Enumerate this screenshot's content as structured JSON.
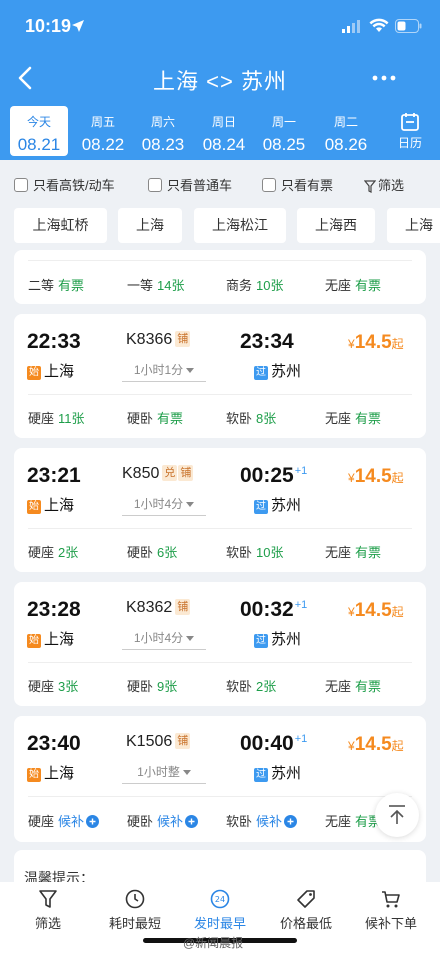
{
  "status_bar": {
    "time": "10:19"
  },
  "header": {
    "title": "上海 <> 苏州"
  },
  "dates": [
    {
      "weekday": "今天",
      "date": "08.21",
      "active": true
    },
    {
      "weekday": "周五",
      "date": "08.22"
    },
    {
      "weekday": "周六",
      "date": "08.23"
    },
    {
      "weekday": "周日",
      "date": "08.24"
    },
    {
      "weekday": "周一",
      "date": "08.25"
    },
    {
      "weekday": "周二",
      "date": "08.26"
    }
  ],
  "calendar_label": "日历",
  "filters": {
    "high_speed": "只看高铁/动车",
    "regular": "只看普通车",
    "available": "只看有票",
    "filter_label": "筛选"
  },
  "stations": [
    "上海虹桥",
    "上海",
    "上海松江",
    "上海西",
    "上海"
  ],
  "partial_seats": [
    {
      "type": "二等",
      "status": "有票"
    },
    {
      "type": "一等",
      "status": "14张"
    },
    {
      "type": "商务",
      "status": "10张"
    },
    {
      "type": "无座",
      "status": "有票"
    }
  ],
  "trains": [
    {
      "dep_time": "22:33",
      "dep_badge": "始",
      "dep_station": "上海",
      "train_no": "K8366",
      "tags": [
        "铺"
      ],
      "duration": "1小时1分",
      "arr_time": "23:34",
      "arr_plus": "",
      "arr_badge": "过",
      "arr_station": "苏州",
      "price_currency": "¥",
      "price": "14.5",
      "price_suffix": "起",
      "seats": [
        {
          "type": "硬座",
          "status": "11张"
        },
        {
          "type": "硬卧",
          "status": "有票"
        },
        {
          "type": "软卧",
          "status": "8张"
        },
        {
          "type": "无座",
          "status": "有票"
        }
      ]
    },
    {
      "dep_time": "23:21",
      "dep_badge": "始",
      "dep_station": "上海",
      "train_no": "K850",
      "tags": [
        "兑",
        "铺"
      ],
      "duration": "1小时4分",
      "arr_time": "00:25",
      "arr_plus": "+1",
      "arr_badge": "过",
      "arr_station": "苏州",
      "price_currency": "¥",
      "price": "14.5",
      "price_suffix": "起",
      "seats": [
        {
          "type": "硬座",
          "status": "2张"
        },
        {
          "type": "硬卧",
          "status": "6张"
        },
        {
          "type": "软卧",
          "status": "10张"
        },
        {
          "type": "无座",
          "status": "有票"
        }
      ]
    },
    {
      "dep_time": "23:28",
      "dep_badge": "始",
      "dep_station": "上海",
      "train_no": "K8362",
      "tags": [
        "铺"
      ],
      "duration": "1小时4分",
      "arr_time": "00:32",
      "arr_plus": "+1",
      "arr_badge": "过",
      "arr_station": "苏州",
      "price_currency": "¥",
      "price": "14.5",
      "price_suffix": "起",
      "seats": [
        {
          "type": "硬座",
          "status": "3张"
        },
        {
          "type": "硬卧",
          "status": "9张"
        },
        {
          "type": "软卧",
          "status": "2张"
        },
        {
          "type": "无座",
          "status": "有票"
        }
      ]
    },
    {
      "dep_time": "23:40",
      "dep_badge": "始",
      "dep_station": "上海",
      "train_no": "K1506",
      "tags": [
        "铺"
      ],
      "duration": "1小时整",
      "arr_time": "00:40",
      "arr_plus": "+1",
      "arr_badge": "过",
      "arr_station": "苏州",
      "price_currency": "¥",
      "price": "14.5",
      "price_suffix": "起",
      "seats": [
        {
          "type": "硬座",
          "status": "候补"
        },
        {
          "type": "硬卧",
          "status": "候补"
        },
        {
          "type": "软卧",
          "status": "候补"
        },
        {
          "type": "无座",
          "status": "有票"
        }
      ]
    }
  ],
  "tip": {
    "title": "温馨提示："
  },
  "bottom_tabs": [
    {
      "label": "筛选",
      "icon": "funnel-icon"
    },
    {
      "label": "耗时最短",
      "icon": "clock-icon"
    },
    {
      "label": "发时最早",
      "icon": "24h-icon",
      "active": true
    },
    {
      "label": "价格最低",
      "icon": "price-tag-icon"
    },
    {
      "label": "候补下单",
      "icon": "cart-icon"
    }
  ],
  "watermark": "@新闻晨报",
  "colors": {
    "header_blue": "#3d9af0",
    "ticket_green": "#1e9e4a",
    "price_orange": "#f58a1f",
    "active_blue": "#2b86e5"
  }
}
